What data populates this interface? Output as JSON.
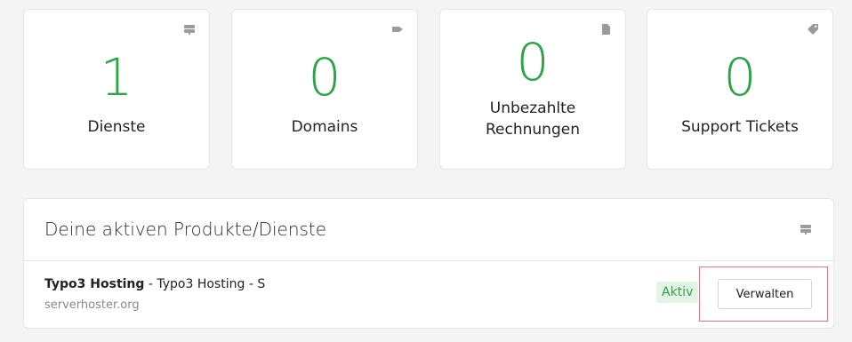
{
  "stats": [
    {
      "value": "1",
      "label": "Dienste",
      "icon": "server-icon"
    },
    {
      "value": "0",
      "label": "Domains",
      "icon": "tag-icon"
    },
    {
      "value": "0",
      "label_line1": "Unbezahlte",
      "label_line2": "Rechnungen",
      "icon": "document-icon"
    },
    {
      "value": "0",
      "label": "Support Tickets",
      "icon": "ticket-icon"
    }
  ],
  "panel": {
    "title": "Deine aktiven Produkte/Dienste",
    "icon": "server-icon",
    "products": [
      {
        "name": "Typo3 Hosting",
        "detail": " - Typo3 Hosting - S",
        "domain": "serverhoster.org",
        "status": "Aktiv",
        "action": "Verwalten"
      }
    ]
  },
  "colors": {
    "accent": "#2ea24a",
    "highlight": "#e07a84",
    "badge_bg": "#e3f4e6"
  }
}
